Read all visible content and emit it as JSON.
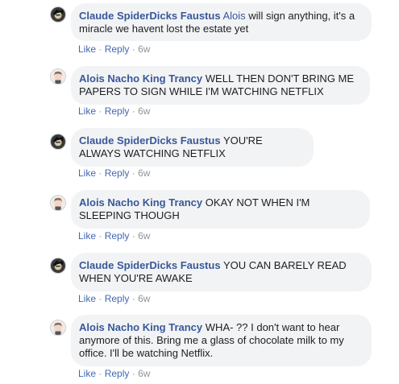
{
  "comments": [
    {
      "author": "Claude SpiderDicks Faustus",
      "mention": "Alois",
      "text": "will sign anything, it's a miracle we havent lost the estate yet",
      "like_label": "Like",
      "reply_label": "Reply",
      "time": "6w",
      "avatar_icon": "claude-avatar-icon"
    },
    {
      "author": "Alois Nacho King Trancy",
      "text": "WELL THEN DON'T BRING ME PAPERS TO SIGN WHILE I'M WATCHING NETFLIX",
      "like_label": "Like",
      "reply_label": "Reply",
      "time": "6w",
      "avatar_icon": "alois-avatar-icon"
    },
    {
      "author": "Claude SpiderDicks Faustus",
      "text": "YOU'RE ALWAYS WATCHING NETFLIX",
      "like_label": "Like",
      "reply_label": "Reply",
      "time": "6w",
      "avatar_icon": "claude-avatar-icon"
    },
    {
      "author": "Alois Nacho King Trancy",
      "text": "OKAY NOT WHEN I'M SLEEPING THOUGH",
      "like_label": "Like",
      "reply_label": "Reply",
      "time": "6w",
      "avatar_icon": "alois-avatar-icon"
    },
    {
      "author": "Claude SpiderDicks Faustus",
      "text": "YOU CAN BARELY READ WHEN YOU'RE AWAKE",
      "like_label": "Like",
      "reply_label": "Reply",
      "time": "6w",
      "avatar_icon": "claude-avatar-icon"
    },
    {
      "author": "Alois Nacho King Trancy",
      "text": "WHA- ?? I don't want to hear anymore of this. Bring me a glass of chocolate milk to my office. I'll be watching Netflix.",
      "like_label": "Like",
      "reply_label": "Reply",
      "time": "6w",
      "avatar_icon": "alois-avatar-icon"
    }
  ],
  "colors": {
    "author": "#385898",
    "action_link": "#4267b2",
    "bubble": "#f2f3f5",
    "meta": "#90949c"
  }
}
